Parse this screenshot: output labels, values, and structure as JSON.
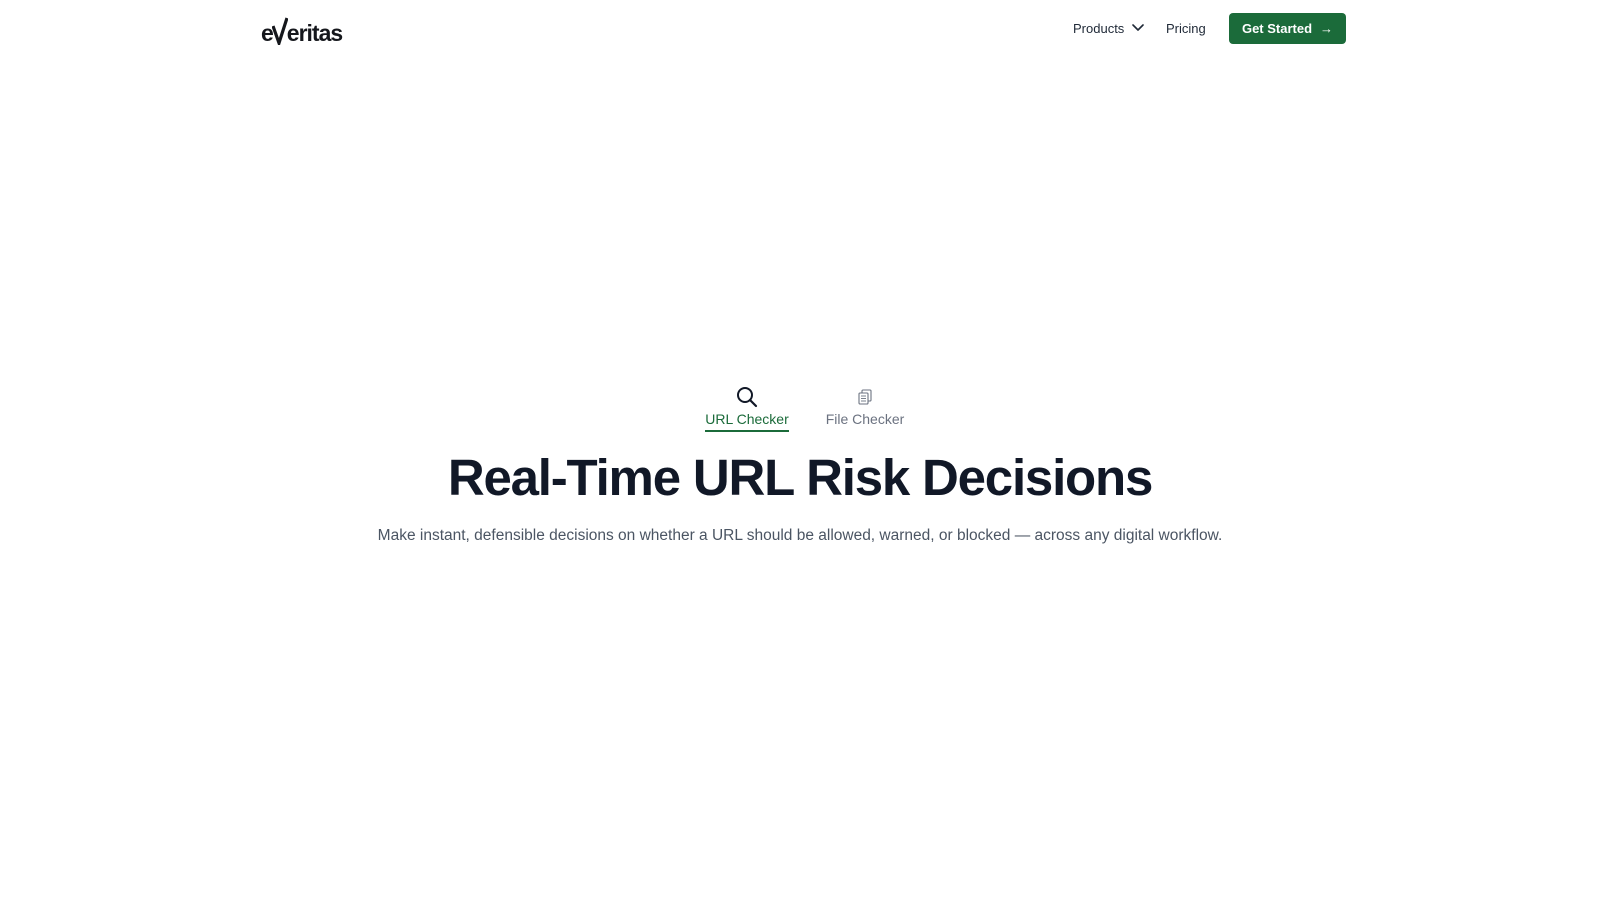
{
  "header": {
    "logo": {
      "prefix": "e",
      "suffix": "eritas",
      "icon": "v-checkmark-logo"
    },
    "nav": {
      "products_label": "Products",
      "products_icon": "chevron-down-icon",
      "pricing_label": "Pricing",
      "cta_label": "Get Started",
      "cta_arrow": "→"
    }
  },
  "hero": {
    "tabs": [
      {
        "label": "URL Checker",
        "icon": "search-icon",
        "active": true
      },
      {
        "label": "File Checker",
        "icon": "document-copy-icon",
        "active": false
      }
    ],
    "title": "Real-Time URL Risk Decisions",
    "subtitle": "Make instant, defensible decisions on whether a URL should be allowed, warned, or blocked — across any digital workflow."
  },
  "colors": {
    "brand_green": "#1b6b3a",
    "text_dark": "#111827",
    "text_muted": "#4b5563",
    "tab_inactive": "#6b7280",
    "background": "#ffffff"
  }
}
